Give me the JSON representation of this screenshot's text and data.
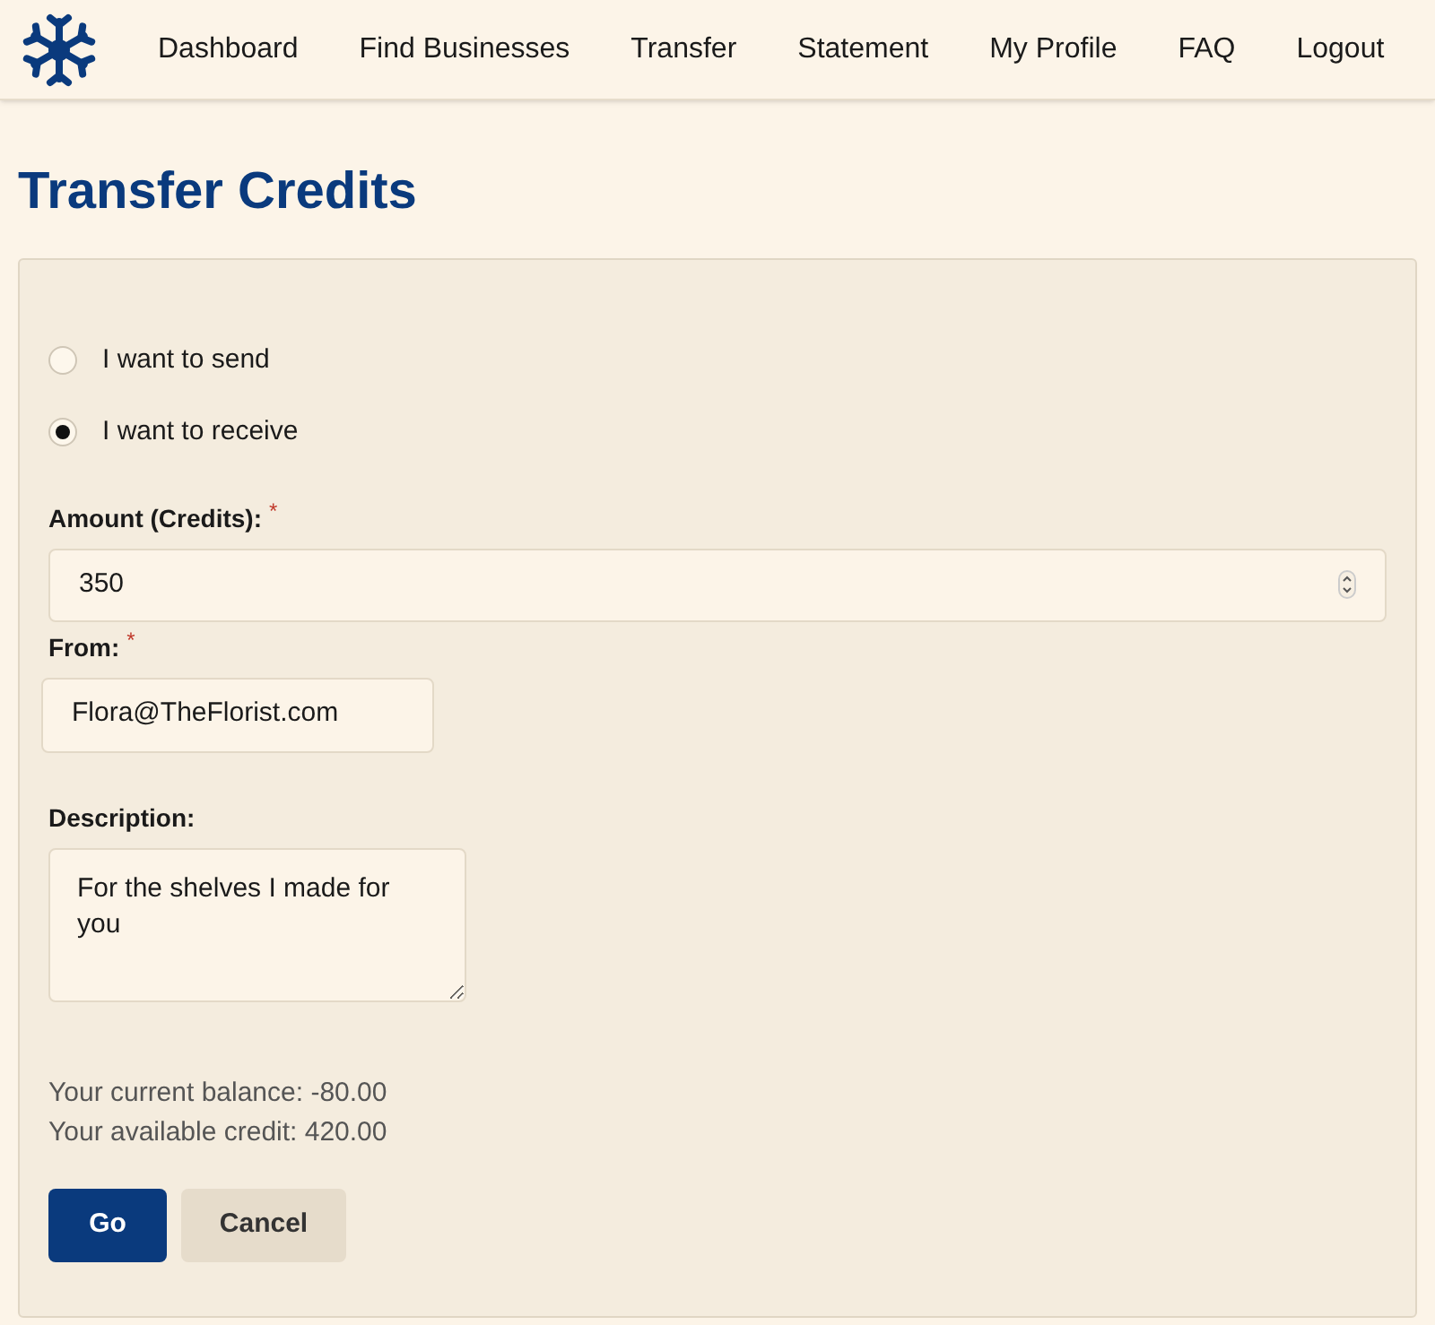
{
  "nav": {
    "items": [
      {
        "label": "Dashboard"
      },
      {
        "label": "Find Businesses"
      },
      {
        "label": "Transfer"
      },
      {
        "label": "Statement"
      },
      {
        "label": "My Profile"
      },
      {
        "label": "FAQ"
      },
      {
        "label": "Logout"
      }
    ]
  },
  "title": "Transfer Credits",
  "direction": [
    {
      "label": "I want to send",
      "selected": false
    },
    {
      "label": "I want to receive",
      "selected": true
    }
  ],
  "amount": {
    "label": "Amount (Credits):",
    "required_mark": "*",
    "value": "350"
  },
  "from": {
    "label": "From:",
    "required_mark": "*",
    "value": "Flora@TheFlorist.com"
  },
  "description": {
    "label": "Description:",
    "value": "For the shelves I made for you"
  },
  "balance_lines": [
    "Your current balance: -80.00",
    "Your available credit: 420.00"
  ],
  "buttons": [
    {
      "label": "Go",
      "kind": "primary"
    },
    {
      "label": "Cancel",
      "kind": "secondary"
    }
  ]
}
